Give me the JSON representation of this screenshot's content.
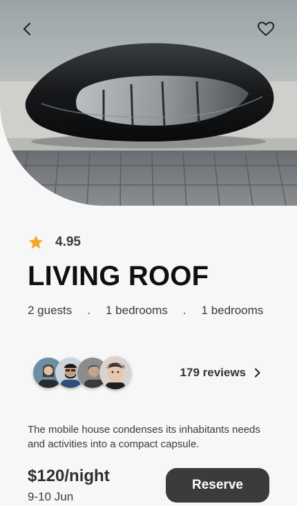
{
  "hero": {
    "image_alt": "Futuristic black capsule house on rooftop",
    "back_icon": "chevron-left-icon",
    "favorite_icon": "heart-outline-icon"
  },
  "listing": {
    "rating": "4.95",
    "title": "LIVING ROOF",
    "specs": [
      "2 guests",
      ".",
      "1 bedrooms",
      ".",
      "1 bedrooms"
    ],
    "reviews_label": "179 reviews",
    "description": "The mobile house condenses its inhabitants needs and activities into a compact capsule.",
    "price": "$120/night",
    "dates": "9-10 Jun",
    "reserve_label": "Reserve"
  },
  "colors": {
    "accent_star": "#f5a623",
    "button": "#3b3b3b",
    "background": "#f7f7f7"
  }
}
